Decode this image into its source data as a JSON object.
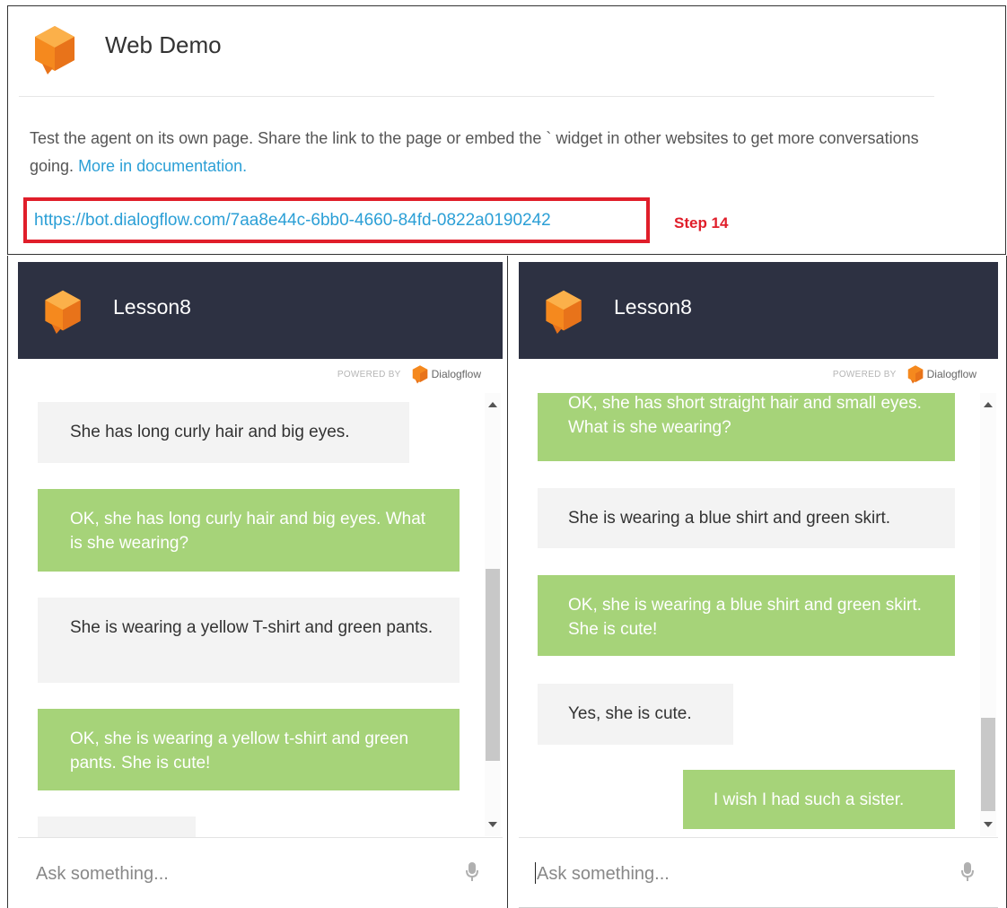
{
  "top": {
    "title": "Web Demo",
    "description": "Test the agent on its own page. Share the link to the page or embed the ` widget in other websites to get more conversations going.",
    "doc_link": "More in documentation.",
    "bot_url": "https://bot.dialogflow.com/7aa8e44c-6bb0-4660-84fd-0822a0190242",
    "step_label": "Step 14"
  },
  "colors": {
    "accent_orange": "#f5891e",
    "header_dark": "#2d3142",
    "user_bubble": "#a6d379",
    "bot_bubble": "#f3f3f3",
    "link_blue": "#2b9fd6",
    "highlight_red": "#e01e2a"
  },
  "left_chat": {
    "title": "Lesson8",
    "powered_by": "POWERED BY",
    "brand": "Dialogflow",
    "input_placeholder": "Ask something...",
    "messages": [
      {
        "role": "bot",
        "text": "She has long curly hair and big eyes."
      },
      {
        "role": "user",
        "text": "OK, she has long curly hair and big eyes. What is she wearing?"
      },
      {
        "role": "bot",
        "text": "She is wearing a yellow T-shirt and green pants."
      },
      {
        "role": "user",
        "text": "OK, she is wearing a yellow t-shirt and green pants. She is cute!"
      }
    ]
  },
  "right_chat": {
    "title": "Lesson8",
    "powered_by": "POWERED BY",
    "brand": "Dialogflow",
    "input_placeholder": "Ask something...",
    "messages": [
      {
        "role": "user",
        "text": "OK, she has short straight hair and small eyes. What is she wearing?"
      },
      {
        "role": "bot",
        "text": "She is wearing a blue shirt and green skirt."
      },
      {
        "role": "user",
        "text": "OK, she is wearing a blue shirt and green skirt. She is cute!"
      },
      {
        "role": "bot",
        "text": "Yes, she is cute."
      },
      {
        "role": "user",
        "text": "I wish I had such a sister."
      }
    ]
  },
  "icons": [
    "agent-cube-icon",
    "dialogflow-logo-icon",
    "microphone-icon",
    "scroll-up-icon",
    "scroll-down-icon"
  ]
}
